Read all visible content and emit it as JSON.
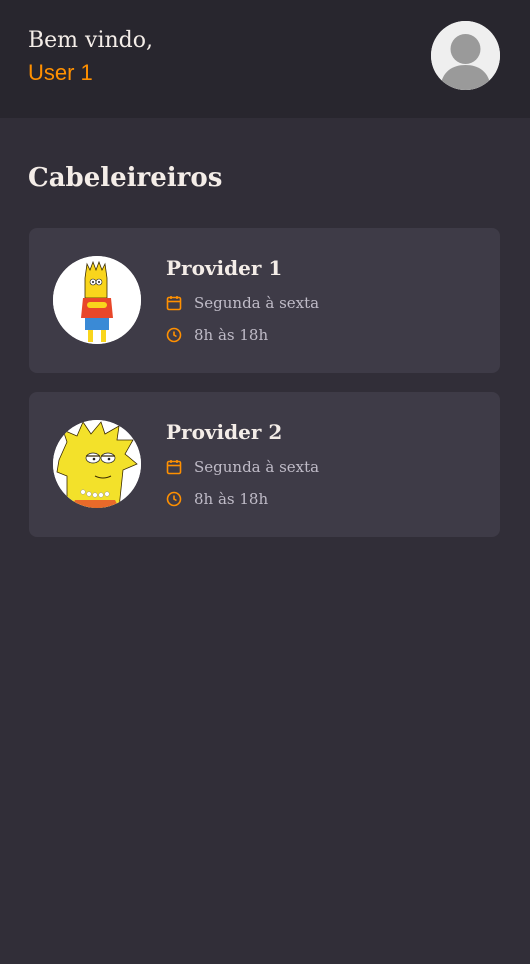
{
  "header": {
    "welcome": "Bem vindo,",
    "username": "User 1"
  },
  "section": {
    "title": "Cabeleireiros"
  },
  "providers": [
    {
      "name": "Provider 1",
      "days": "Segunda à sexta",
      "hours": "8h às 18h",
      "avatar_icon": "bart-avatar"
    },
    {
      "name": "Provider 2",
      "days": "Segunda à sexta",
      "hours": "8h às 18h",
      "avatar_icon": "lisa-avatar"
    }
  ],
  "colors": {
    "background": "#312e38",
    "header": "#28262e",
    "card": "#3e3b47",
    "accent": "#ff9000",
    "text": "#f4ede8",
    "muted": "#bfbbc7"
  }
}
